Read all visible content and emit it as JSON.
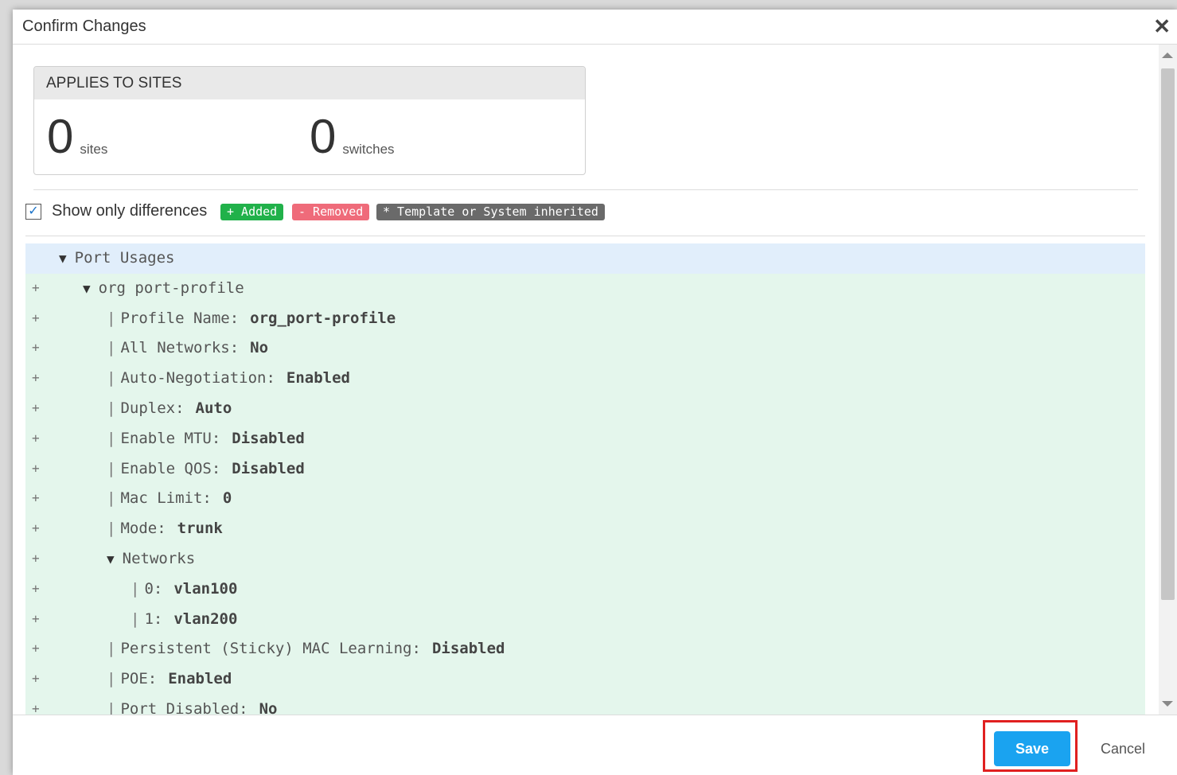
{
  "dialog": {
    "title": "Confirm Changes",
    "close_symbol": "✕"
  },
  "applies": {
    "heading": "APPLIES TO SITES",
    "sites_count": "0",
    "sites_label": "sites",
    "switches_count": "0",
    "switches_label": "switches"
  },
  "filter": {
    "checked": true,
    "check_mark": "✓",
    "label": "Show only differences",
    "badges": {
      "added": "+ Added",
      "removed": "- Removed",
      "inherited": "* Template or System inherited"
    },
    "colors": {
      "added": "#21b14a",
      "removed": "#ef6b7a",
      "inherited": "#6a6a6a"
    }
  },
  "tree": {
    "root": "Port Usages",
    "profile": "org port-profile",
    "plus": "+",
    "rows": [
      {
        "key": "Profile Name:",
        "value": "org_port-profile"
      },
      {
        "key": "All Networks:",
        "value": "No"
      },
      {
        "key": "Auto-Negotiation:",
        "value": "Enabled"
      },
      {
        "key": "Duplex:",
        "value": "Auto"
      },
      {
        "key": "Enable MTU:",
        "value": "Disabled"
      },
      {
        "key": "Enable QOS:",
        "value": "Disabled"
      },
      {
        "key": "Mac Limit:",
        "value": "0"
      },
      {
        "key": "Mode:",
        "value": "trunk"
      }
    ],
    "networks_label": "Networks",
    "networks": [
      {
        "key": "0:",
        "value": "vlan100"
      },
      {
        "key": "1:",
        "value": "vlan200"
      }
    ],
    "rows_after": [
      {
        "key": "Persistent (Sticky) MAC Learning:",
        "value": "Disabled"
      },
      {
        "key": "POE:",
        "value": "Enabled"
      },
      {
        "key": "Port Disabled:",
        "value": "No"
      }
    ]
  },
  "footer": {
    "save_label": "Save",
    "cancel_label": "Cancel"
  }
}
